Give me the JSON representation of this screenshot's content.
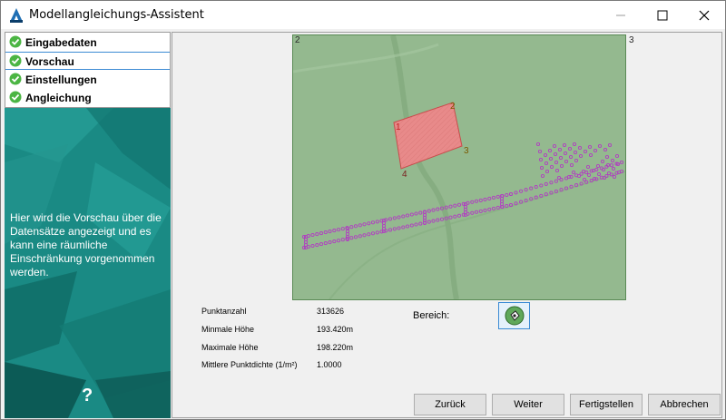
{
  "window": {
    "title": "Modellangleichungs-Assistent"
  },
  "steps": [
    {
      "label": "Eingabedaten"
    },
    {
      "label": "Vorschau"
    },
    {
      "label": "Einstellungen"
    },
    {
      "label": "Angleichung"
    }
  ],
  "sidebar": {
    "description": "Hier wird die Vorschau über die Datensätze angezeigt und es kann eine räumliche Einschränkung vorgenommen werden.",
    "help": "?"
  },
  "map": {
    "corners": {
      "top_left": "2",
      "top_right": "3"
    },
    "polygon_labels": [
      "1",
      "2",
      "3",
      "4"
    ]
  },
  "stats": [
    {
      "label": "Punktanzahl",
      "value": "313626"
    },
    {
      "label": "Minmale Höhe",
      "value": "193.420m"
    },
    {
      "label": "Maximale Höhe",
      "value": "198.220m"
    },
    {
      "label": "Mittlere Punktdichte (1/m²)",
      "value": "1.0000"
    }
  ],
  "bereich": {
    "label": "Bereich:"
  },
  "buttons": {
    "back": "Zurück",
    "next": "Weiter",
    "finish": "Fertigstellen",
    "cancel": "Abbrechen"
  },
  "colors": {
    "sidebar": "#1a8a84",
    "map_bg": "#94b98f",
    "polygon": "#e88a8a",
    "points": "#b040c0",
    "accent": "#3c8bd4"
  }
}
